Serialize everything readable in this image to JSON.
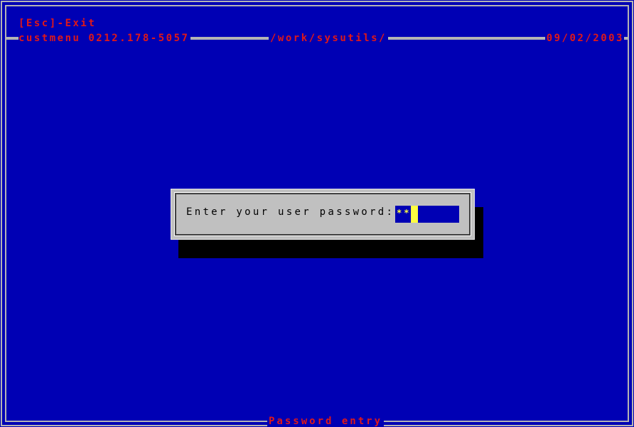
{
  "header": {
    "exit_hint": "[Esc]-Exit",
    "program_info": "custmenu 0212.178-5057",
    "path": "/work/sysutils/",
    "date": "09/02/2003"
  },
  "dialog": {
    "prompt": "Enter your user password:",
    "password_mask": "**"
  },
  "footer": {
    "title": "Password entry"
  },
  "colors": {
    "background": "#0000b4",
    "title_text": "#e01818",
    "dialog_bg": "#c0c0c0",
    "input_text": "#ffff40"
  }
}
